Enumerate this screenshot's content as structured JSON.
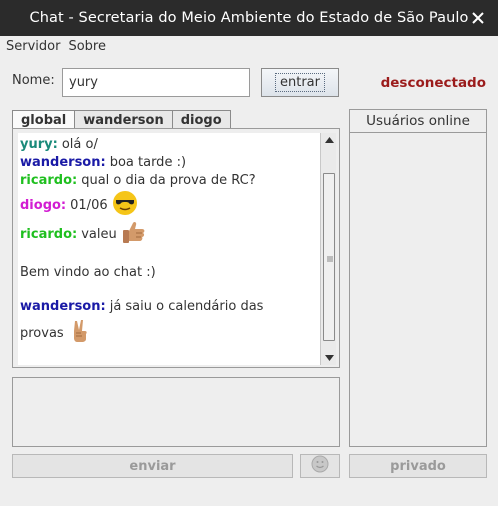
{
  "window": {
    "title": "Chat - Secretaria do Meio Ambiente do Estado de São Paulo"
  },
  "menu": {
    "items": [
      "Servidor",
      "Sobre"
    ]
  },
  "login": {
    "name_label": "Nome:",
    "name_value": "yury",
    "enter_button": "entrar",
    "status": "desconectado",
    "status_color": "#9b1c1c"
  },
  "tabs": [
    "global",
    "wanderson",
    "diogo"
  ],
  "messages": [
    {
      "user": "yury:",
      "text": "olá o/",
      "color": "#1a8a7a"
    },
    {
      "user": "wanderson:",
      "text": "boa tarde :)",
      "color": "#1a1aa6"
    },
    {
      "user": "ricardo:",
      "text": "qual o dia da prova de RC?",
      "color": "#1fbf1f"
    },
    {
      "user": "diogo:",
      "text": "01/06",
      "color": "#d21dd2",
      "emoji": "sunglasses-emoji-icon"
    },
    {
      "user": "ricardo:",
      "text": "valeu",
      "color": "#1fbf1f",
      "emoji": "thumbs-up-emoji-icon"
    },
    {
      "user": "",
      "text": "Bem vindo ao chat :)"
    },
    {
      "user": "wanderson:",
      "text": "já saiu o calendário das",
      "color": "#1a1aa6"
    },
    {
      "user": "",
      "text": "provas",
      "emoji": "victory-hand-emoji-icon"
    }
  ],
  "buttons": {
    "send": "enviar",
    "emoji": "smiley-emoji-icon",
    "private": "privado"
  },
  "users": {
    "header": "Usuários online"
  }
}
